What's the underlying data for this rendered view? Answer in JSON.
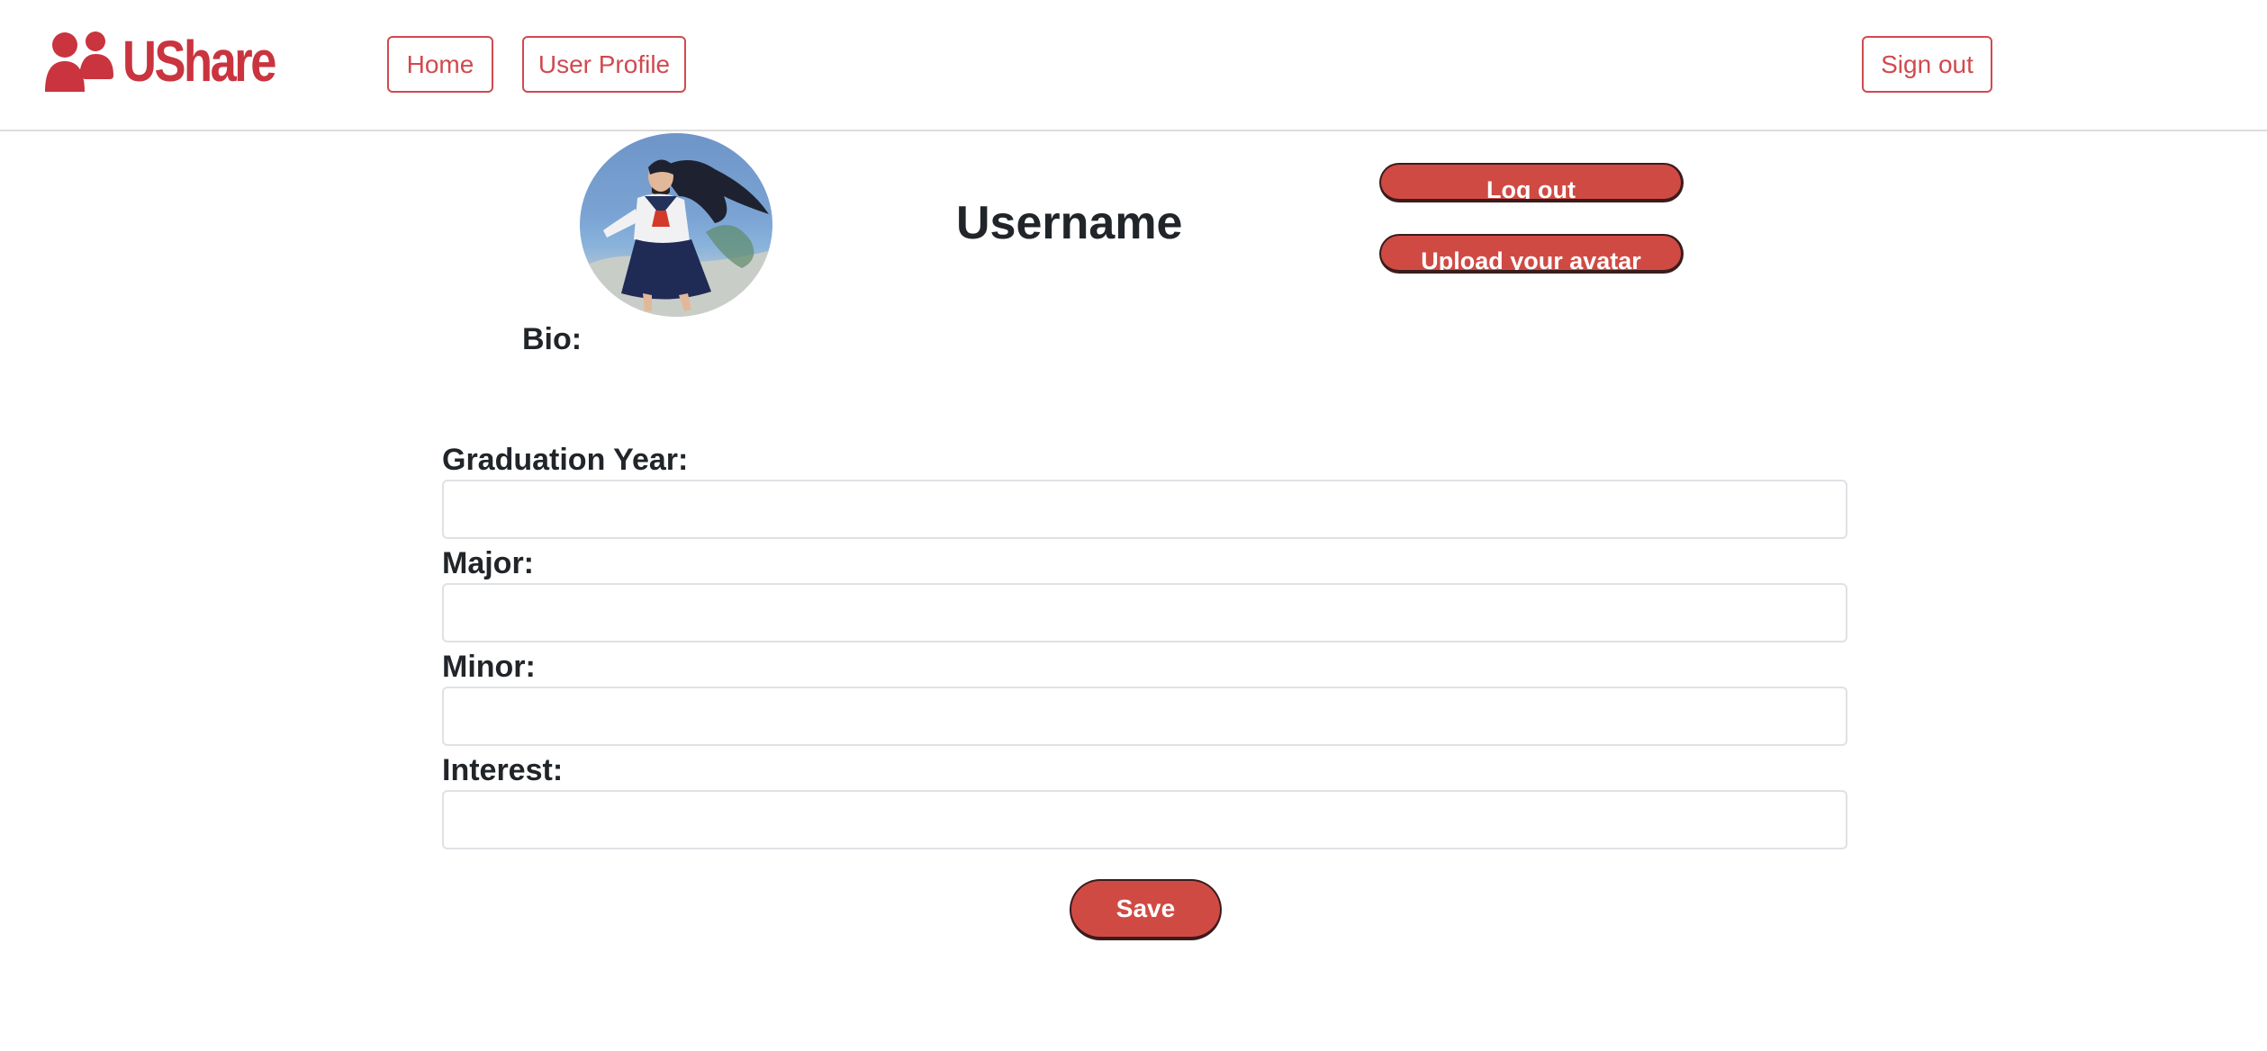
{
  "brand": {
    "name": "UShare",
    "color": "#c9343f"
  },
  "nav": {
    "home_label": "Home",
    "profile_label": "User Profile",
    "signout_label": "Sign out"
  },
  "profile": {
    "username": "Username",
    "logout_label": "Log out",
    "upload_label": "Upload your avatar",
    "bio_label": "Bio:"
  },
  "form": {
    "fields": [
      {
        "label": "Graduation Year:",
        "value": ""
      },
      {
        "label": "Major:",
        "value": ""
      },
      {
        "label": "Minor:",
        "value": ""
      },
      {
        "label": "Interest:",
        "value": ""
      }
    ],
    "save_label": "Save"
  },
  "colors": {
    "accent": "#d04a44",
    "nav_outline": "#d04a4f"
  }
}
